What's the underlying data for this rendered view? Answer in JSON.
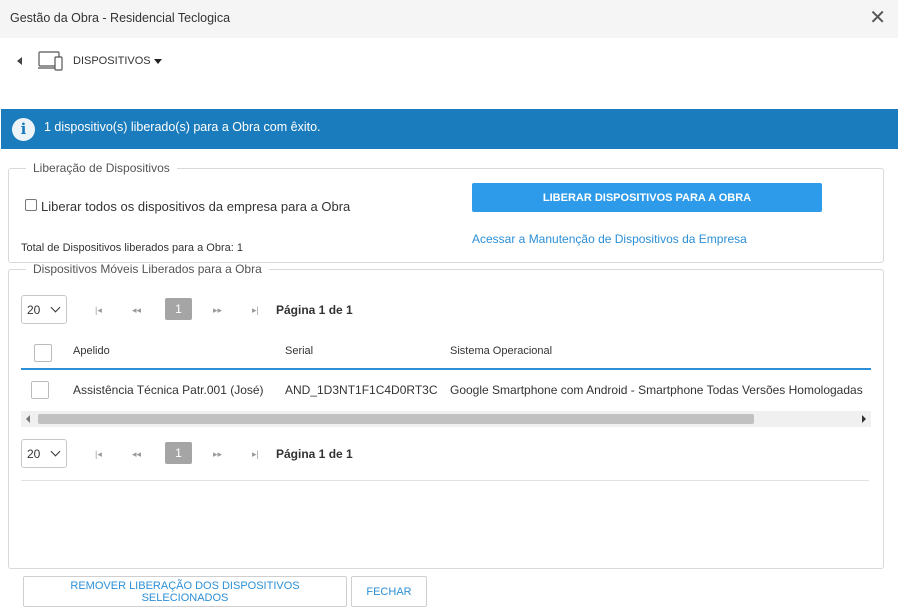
{
  "window": {
    "title": "Gestão da Obra - Residencial Teclogica",
    "close_icon": "close-icon"
  },
  "breadcrumb": {
    "label": "DISPOSITIVOS",
    "icon": "devices-icon"
  },
  "alert": {
    "text": "1 dispositivo(s) liberado(s) para a Obra com êxito.",
    "icon": "info-icon",
    "color": "#1b7cbd"
  },
  "release": {
    "legend": "Liberação de Dispositivos",
    "checkbox_label": "Liberar todos os dispositivos da empresa para a Obra",
    "checkbox_checked": false,
    "total_text": "Total de Dispositivos liberados para a Obra: 1",
    "release_button": "LIBERAR DISPOSITIVOS PARA A OBRA",
    "manage_link": "Acessar a Manutenção de Dispositivos da Empresa",
    "accent": "#2d9bea"
  },
  "devices": {
    "legend": "Dispositivos Móveis Liberados para a Obra",
    "page_size": "20",
    "current_page": "1",
    "page_info": "Página 1 de 1",
    "columns": [
      "Apelido",
      "Serial",
      "Sistema Operacional"
    ],
    "rows": [
      [
        "Assistência Técnica Patr.001 (José)",
        "AND_1D3NT1F1C4D0RT3C",
        "Google Smartphone com Android - Smartphone Todas Versões Homologadas"
      ]
    ]
  },
  "footer": {
    "remove_button": "REMOVER LIBERAÇÃO DOS DISPOSITIVOS SELECIONADOS",
    "close_button": "FECHAR"
  }
}
